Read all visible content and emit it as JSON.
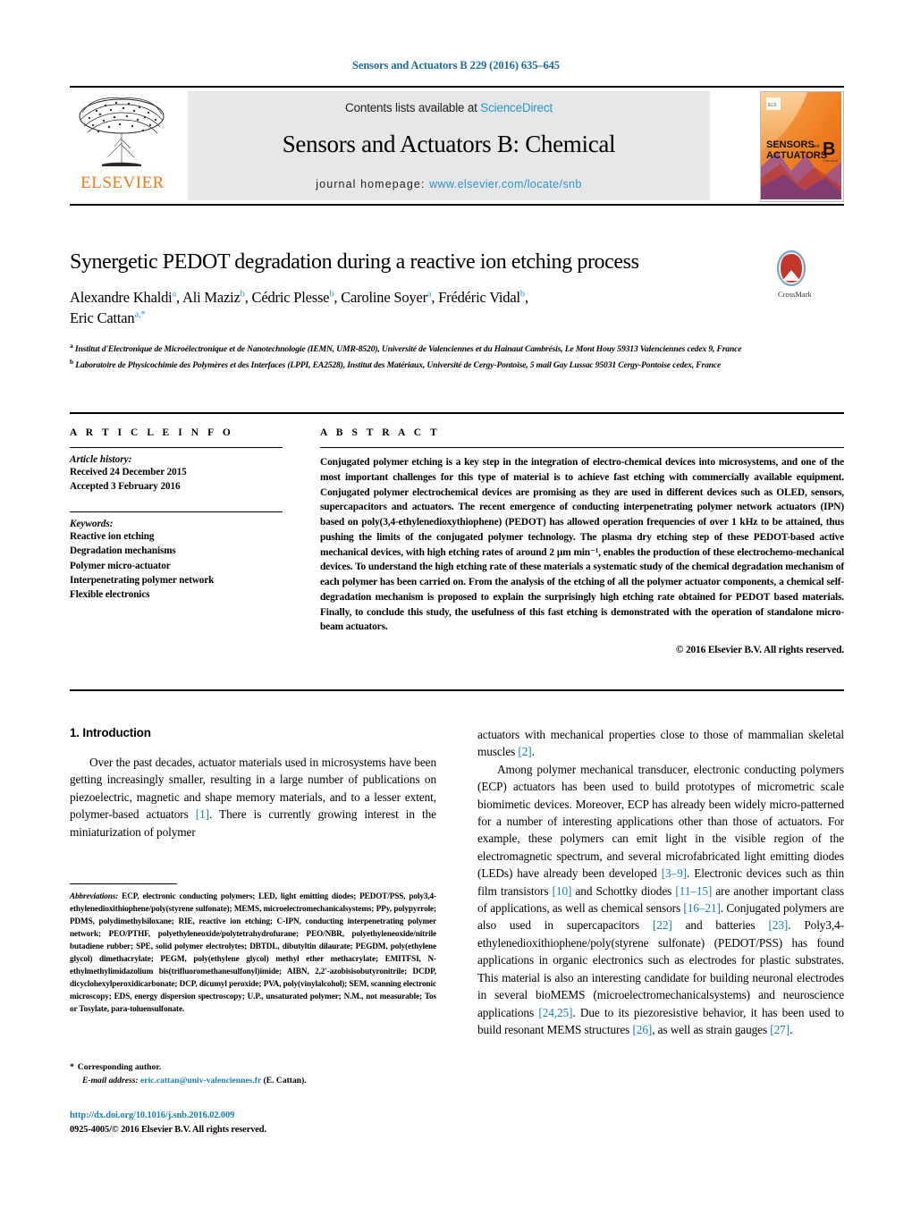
{
  "running_head": "Sensors and Actuators B 229 (2016) 635–645",
  "masthead": {
    "contents_prefix": "Contents lists available at ",
    "sciencedirect": "ScienceDirect",
    "journal_title": "Sensors and Actuators B: Chemical",
    "homepage_label": "journal homepage:",
    "homepage_url": "www.elsevier.com/locate/snb",
    "publisher_wordmark": "ELSEVIER",
    "cover_line1": "SENSORS",
    "cover_and": "and",
    "cover_line2": "ACTUATORS",
    "cover_letter": "B",
    "cover_sub": "Chemical",
    "accent_orange": "#ef7c22",
    "accent_blue": "#2a93c9"
  },
  "title_block": {
    "title": "Synergetic PEDOT degradation during a reactive ion etching process",
    "authors_line1": "Alexandre Khaldi",
    "authors_line1_sup1": "a",
    "authors_rest": ", Ali Maziz",
    "crossmark_label": "CrossMark",
    "authors": [
      {
        "name": "Alexandre Khaldi",
        "sup": "a",
        "sep": ", "
      },
      {
        "name": "Ali Maziz",
        "sup": "b",
        "sep": ", "
      },
      {
        "name": "Cédric Plesse",
        "sup": "b",
        "sep": ", "
      },
      {
        "name": "Caroline Soyer",
        "sup": "a",
        "sep": ", "
      },
      {
        "name": "Frédéric Vidal",
        "sup": "b",
        "sep": ","
      },
      {
        "name": "Eric Cattan",
        "sup": "a,*",
        "sep": ""
      }
    ]
  },
  "affiliations": [
    {
      "marker": "a",
      "text": "Institut d'Electronique de Microélectronique et de Nanotechnologie (IEMN, UMR-8520), Université de Valenciennes et du Hainaut Cambrésis, Le Mont Houy 59313 Valenciennes cedex 9, France"
    },
    {
      "marker": "b",
      "text": "Laboratoire de Physicochimie des Polymères et des Interfaces (LPPI, EA2528), Institut des Matériaux, Université de Cergy-Pontoise, 5 mail Gay Lussac 95031 Cergy-Pontoise cedex, France"
    }
  ],
  "article_info": {
    "heading": "A R T I C L E    I N F O",
    "history_label": "Article history:",
    "history": [
      "Received 24 December 2015",
      "Accepted 3 February 2016"
    ],
    "keywords_label": "Keywords:",
    "keywords": [
      "Reactive ion etching",
      "Degradation mechanisms",
      "Polymer micro-actuator",
      "Interpenetrating polymer network",
      "Flexible electronics"
    ]
  },
  "abstract": {
    "heading": "A B S T R A C T",
    "body": "Conjugated polymer etching is a key step in the integration of electro-chemical devices into microsystems, and one of the most important challenges for this type of material is to achieve fast etching with commercially available equipment. Conjugated polymer electrochemical devices are promising as they are used in different devices such as OLED, sensors, supercapacitors and actuators. The recent emergence of conducting interpenetrating polymer network actuators (IPN) based on poly(3,4-ethylenedioxythiophene) (PEDOT) has allowed operation frequencies of over 1 kHz to be attained, thus pushing the limits of the conjugated polymer technology. The plasma dry etching step of these PEDOT-based active mechanical devices, with high etching rates of around 2 μm min⁻¹, enables the production of these electrochemo-mechanical devices. To understand the high etching rate of these materials a systematic study of the chemical degradation mechanism of each polymer has been carried on. From the analysis of the etching of all the polymer actuator components, a chemical self-degradation mechanism is proposed to explain the surprisingly high etching rate obtained for PEDOT based materials. Finally, to conclude this study, the usefulness of this fast etching is demonstrated with the operation of standalone micro-beam actuators.",
    "copyright": "© 2016 Elsevier B.V. All rights reserved."
  },
  "sections": {
    "intro_heading": "1.  Introduction",
    "left_paragraphs": [
      "Over the past decades, actuator materials used in microsystems have been getting increasingly smaller, resulting in a large number of publications on piezoelectric, magnetic and shape memory materials, and to a lesser extent, polymer-based actuators [1]. There is currently growing interest in the miniaturization of polymer"
    ],
    "right_paragraph_continuation": "actuators with mechanical properties close to those of mammalian skeletal muscles [2].",
    "right_paragraphs": [
      "Among polymer mechanical transducer, electronic conducting polymers (ECP) actuators has been used to build prototypes of micrometric scale biomimetic devices. Moreover, ECP has already been widely micro-patterned for a number of interesting applications other than those of actuators. For example, these polymers can emit light in the visible region of the electromagnetic spectrum, and several microfabricated light emitting diodes (LEDs) have already been developed [3–9]. Electronic devices such as thin film transistors [10] and Schottky diodes [11–15] are another important class of applications, as well as chemical sensors [16–21]. Conjugated polymers are also used in supercapacitors [22] and batteries [23]. Poly3,4-ethylenedioxithiophene/poly(styrene sulfonate) (PEDOT/PSS) has found applications in organic electronics such as electrodes for plastic substrates. This material is also an interesting candidate for building neuronal electrodes in several bioMEMS (microelectromechanicalsystems) and neuroscience applications [24,25]. Due to its piezoresistive behavior, it has been used to build resonant MEMS structures [26], as well as strain gauges [27]."
    ]
  },
  "footnotes": {
    "abbreviations_label": "Abbreviations:",
    "abbreviations_text": " ECP, electronic conducting polymers; LED, light emitting diodes; PEDOT/PSS, poly3,4-ethylenedioxithiophene/poly(styrene sulfonate); MEMS, microelectromechanicalsystems; PPy, polypyrrole; PDMS, polydimethylsiloxane; RIE, reactive ion etching; C-IPN, conducting interpenetrating polymer network; PEO/PTHF, polyethyleneoxide/polytetrahydrofurane; PEO/NBR, polyethyleneoxide/nitrile butadiene rubber; SPE, solid polymer electrolytes; DBTDL, dibutyltin dilaurate; PEGDM, poly(ethylene glycol) dimethacrylate; PEGM, poly(ethylene glycol) methyl ether methacrylate; EMITFSI, N-ethylmethylimidazolium bis(trifluoromethanesulfonyl)imide; AIBN, 2,2'-azobisisobutyronitrile; DCDP, dicyclohexylperoxidicarbonate; DCP, dicumyl peroxide; PVA, poly(vinylalcohol); SEM, scanning electronic microscopy; EDS, energy dispersion spectroscopy; U.P., unsaturated polymer; N.M., not measurable; Tos or Tosylate, para-toluensulfonate.",
    "corresponding_author": "Corresponding author.",
    "email_label": "E-mail address:",
    "email": "eric.cattan@univ-valenciennes.fr",
    "email_owner": "(E. Cattan).",
    "doi": "http://dx.doi.org/10.1016/j.snb.2016.02.009",
    "issn_line": "0925-4005/© 2016 Elsevier B.V. All rights reserved."
  }
}
